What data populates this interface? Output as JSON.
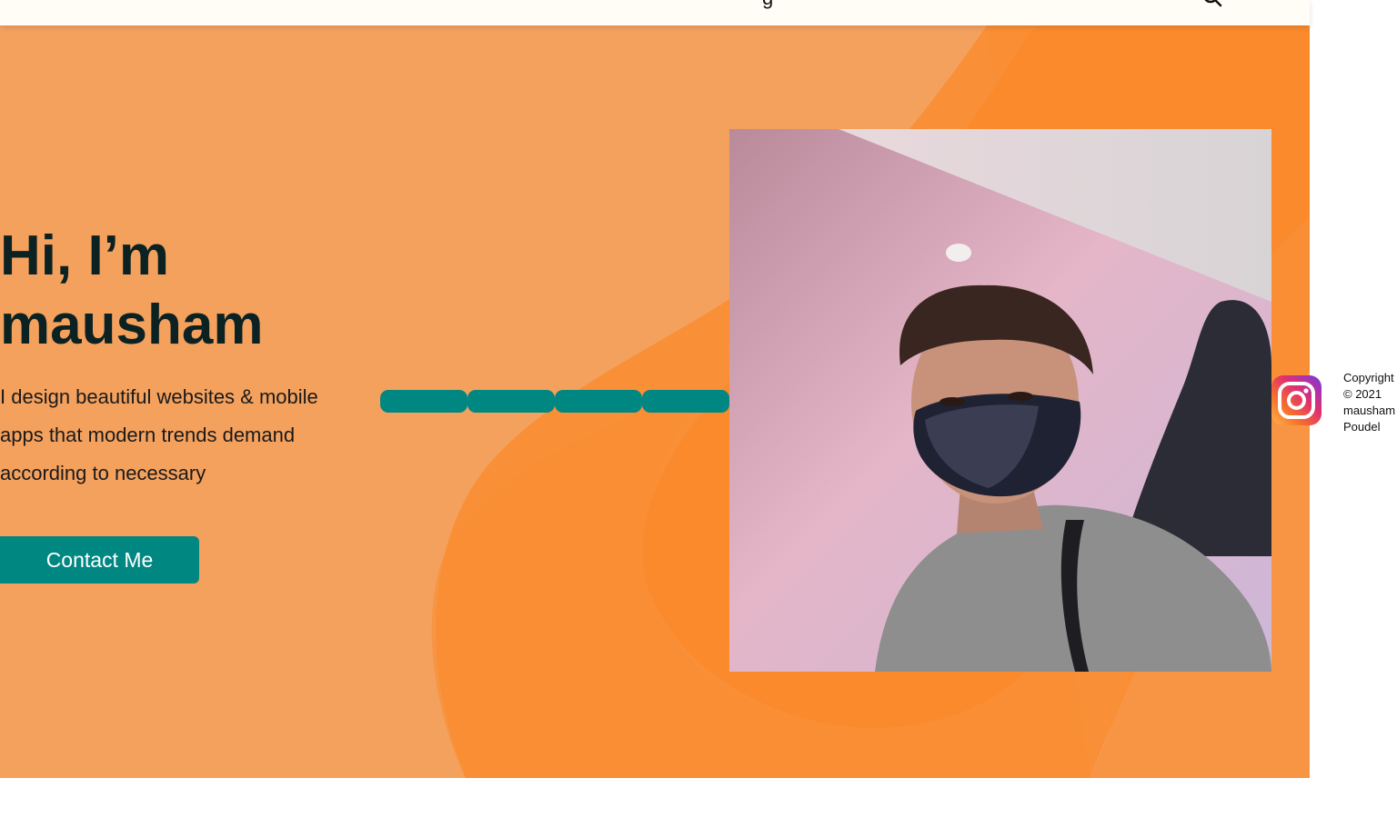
{
  "nav": {
    "partial_link_label": "g",
    "search_icon": "search-icon"
  },
  "hero": {
    "title": "Hi, I’m mausham",
    "subtitle": "I design beautiful websites & mobile apps that modern trends demand according to necessary",
    "contact_button_label": "Contact Me",
    "photo_alt": "mausham",
    "bar_segments": 4
  },
  "sidebar": {
    "social_icon": "instagram-icon",
    "copyright": "Copyright © 2021 mausham Poudel"
  },
  "colors": {
    "hero_background": "#f4a15e",
    "hero_blob": "#f98d32",
    "accent": "#008782",
    "heading": "#0c2222",
    "navbar_background": "#fffdf5"
  }
}
